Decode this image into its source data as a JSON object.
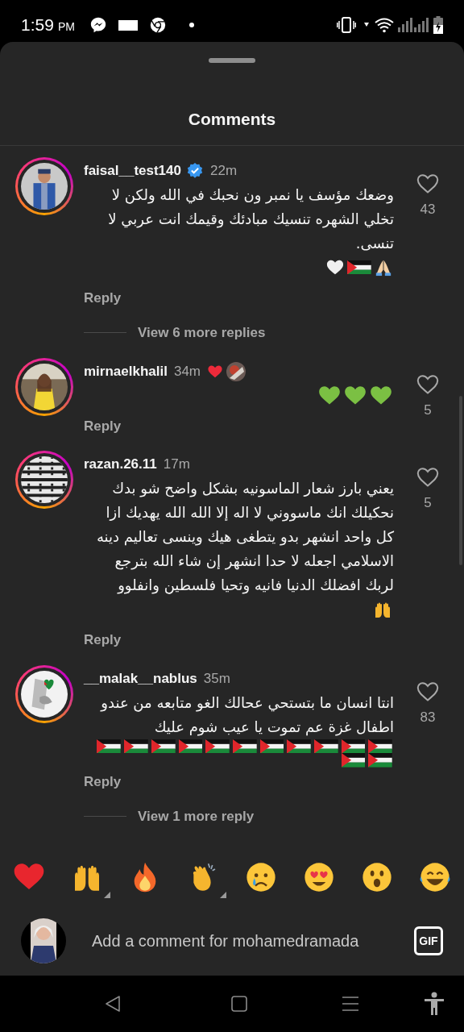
{
  "status_bar": {
    "time": "1:59",
    "ampm": "PM"
  },
  "title": "Comments",
  "comments": [
    {
      "username": "faisal__test140",
      "verified": true,
      "time": "22m",
      "creator_liked": false,
      "text": "وضعك مؤسف يا نمبر ون نحبك في الله ولكن لا تخلي الشهره تنسيك مبادئك وقيمك انت عربي لا تنسى.",
      "emojis": [
        {
          "kind": "pray"
        },
        {
          "kind": "flag"
        },
        {
          "kind": "white-heart"
        }
      ],
      "likes": "43",
      "reply": "Reply",
      "view_replies": "View 6 more replies"
    },
    {
      "username": "mirnaelkhalil",
      "verified": false,
      "time": "34m",
      "creator_liked": true,
      "emojis": [
        {
          "kind": "green-heart"
        },
        {
          "kind": "green-heart"
        },
        {
          "kind": "green-heart"
        }
      ],
      "likes": "5",
      "reply": "Reply"
    },
    {
      "username": "razan.26.11",
      "verified": false,
      "time": "17m",
      "creator_liked": false,
      "text": "يعني بارز شعار الماسونيه بشكل واضح شو بدك نحكيلك انك ماسووني لا اله إلا الله الله يهديك ازا كل واحد انشهر بدو يتطغى هيك وينسى تعاليم دينه الاسلامي اجعله لا حدا انشهر إن شاء الله بترجع لربك افضلك الدنيا فانيه وتحيا فلسطين وانفلوو",
      "emojis": [
        {
          "kind": "raised-hands"
        }
      ],
      "likes": "5",
      "reply": "Reply"
    },
    {
      "username": "__malak__nablus",
      "verified": false,
      "time": "35m",
      "creator_liked": false,
      "text": "انتا انسان ما بتستحي عحالك الغو متابعه من عندو اطفال غزة عم تموت يا عيب شوم عليك",
      "emojis": [
        {
          "kind": "flag"
        },
        {
          "kind": "flag"
        },
        {
          "kind": "flag"
        },
        {
          "kind": "flag"
        },
        {
          "kind": "flag"
        },
        {
          "kind": "flag"
        },
        {
          "kind": "flag"
        },
        {
          "kind": "flag"
        },
        {
          "kind": "flag"
        },
        {
          "kind": "flag"
        },
        {
          "kind": "flag"
        },
        {
          "kind": "flag"
        },
        {
          "kind": "flag"
        }
      ],
      "likes": "83",
      "reply": "Reply",
      "view_replies": "View 1 more reply"
    }
  ],
  "reactions": [
    {
      "kind": "red-heart",
      "variants": false
    },
    {
      "kind": "raised-hands",
      "variants": true
    },
    {
      "kind": "fire",
      "variants": false
    },
    {
      "kind": "clap",
      "variants": true
    },
    {
      "kind": "cry",
      "variants": false
    },
    {
      "kind": "heart-eyes",
      "variants": false
    },
    {
      "kind": "surprised",
      "variants": false
    },
    {
      "kind": "laugh",
      "variants": false
    }
  ],
  "composer": {
    "placeholder": "Add a comment for mohamedramada",
    "gif": "GIF"
  }
}
